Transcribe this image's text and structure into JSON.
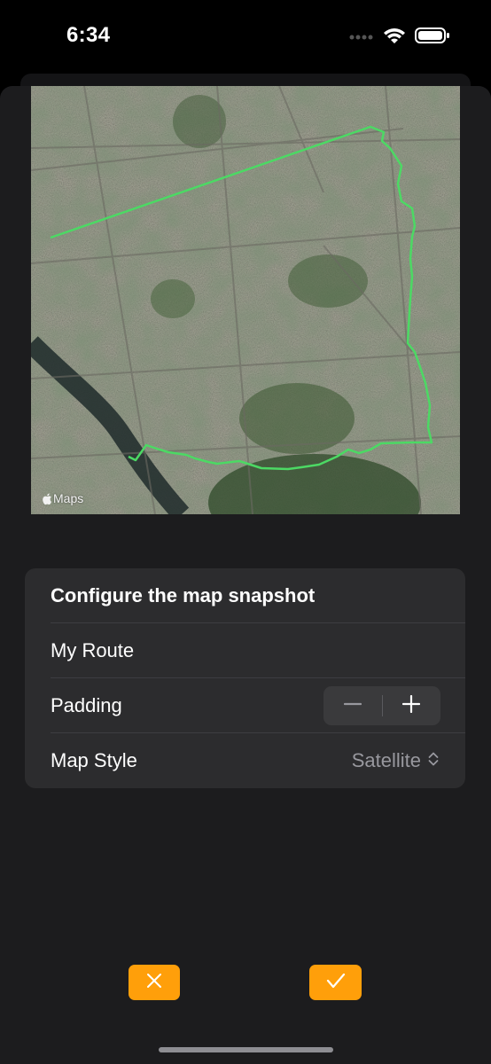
{
  "status_bar": {
    "time": "6:34",
    "icons": [
      "cellular-icon",
      "wifi-icon",
      "battery-icon"
    ]
  },
  "map": {
    "attribution": "Maps",
    "logo_icon": "apple-logo-icon",
    "style": "Satellite",
    "route_color": "#4cd964"
  },
  "form": {
    "header": "Configure the map snapshot",
    "route_name": "My Route",
    "padding_label": "Padding",
    "stepper": {
      "decrement_icon": "minus-icon",
      "increment_icon": "plus-icon"
    },
    "map_style_label": "Map Style",
    "map_style_value": "Satellite",
    "map_style_icon": "chevron-up-down-icon"
  },
  "actions": {
    "cancel_icon": "xmark-icon",
    "confirm_icon": "checkmark-icon",
    "accent_color": "#ff9f0a"
  }
}
